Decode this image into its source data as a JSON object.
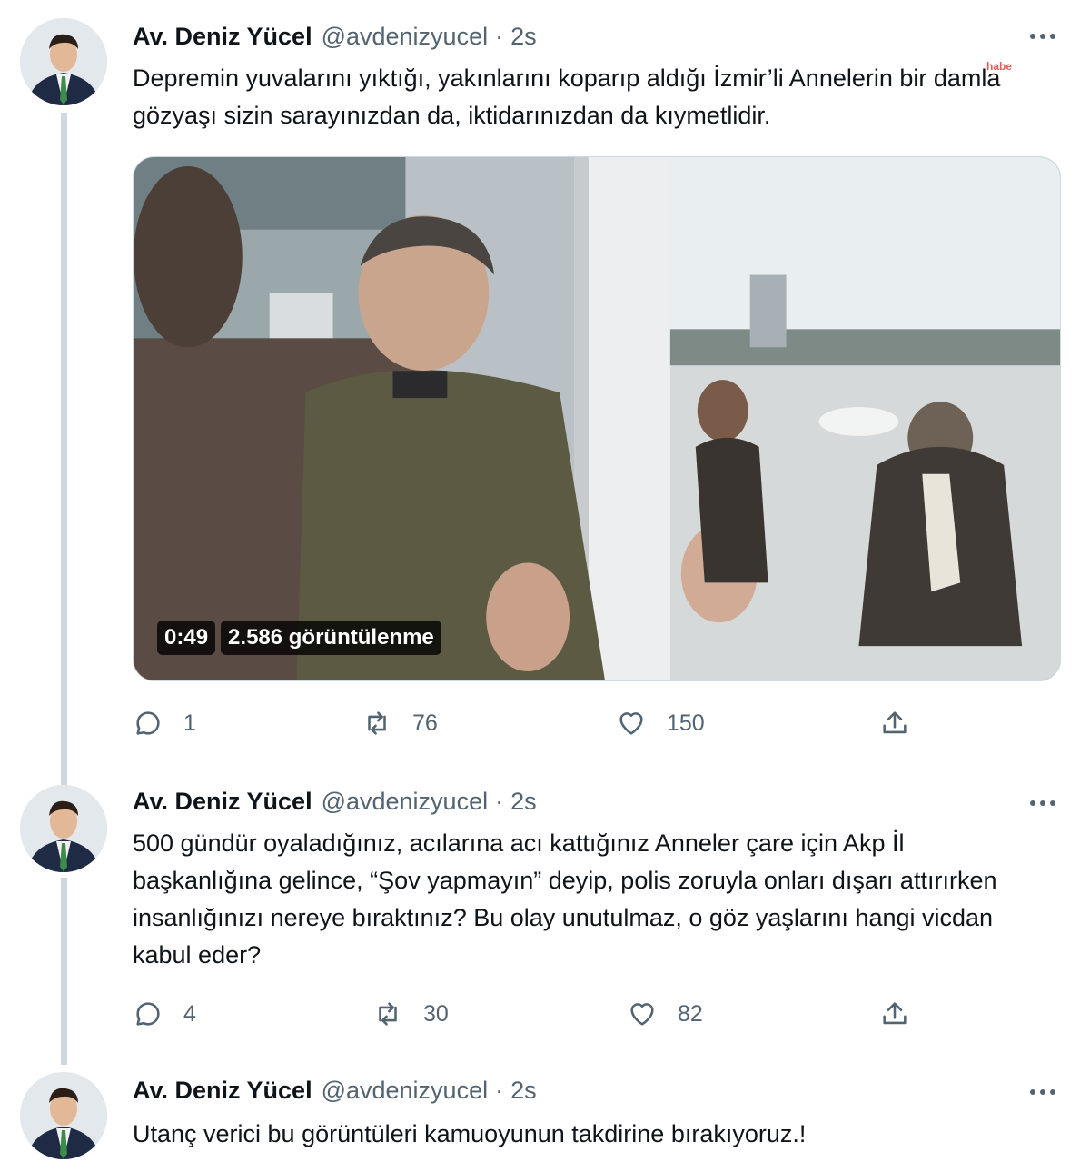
{
  "colors": {
    "text": "#0f1419",
    "secondary": "#536471",
    "thread_line": "#cfd9de"
  },
  "tweets": [
    {
      "author": "Av. Deniz Yücel",
      "handle": "@avdenizyucel",
      "separator": "·",
      "time": "2s",
      "text": "Depremin yuvalarını yıktığı, yakınlarını koparıp aldığı İzmir’li Annelerin bir damla gözyaşı sizin sarayınızdan da, iktidarınızdan da kıymetlidir.",
      "video": {
        "duration": "0:49",
        "views": "2.586 görüntülenme",
        "watermark": "habe"
      },
      "replies": "1",
      "retweets": "76",
      "likes": "150"
    },
    {
      "author": "Av. Deniz Yücel",
      "handle": "@avdenizyucel",
      "separator": "·",
      "time": "2s",
      "text": "500 gündür oyaladığınız, acılarına acı kattığınız Anneler çare için Akp İl başkanlığına gelince, “Şov yapmayın” deyip, polis zoruyla onları dışarı attırırken insanlığınızı nereye bıraktınız? Bu olay unutulmaz, o göz yaşlarını hangi vicdan kabul eder?",
      "replies": "4",
      "retweets": "30",
      "likes": "82"
    },
    {
      "author": "Av. Deniz Yücel",
      "handle": "@avdenizyucel",
      "separator": "·",
      "time": "2s",
      "text": "Utanç verici bu görüntüleri kamuoyunun takdirine bırakıyoruz.!"
    }
  ],
  "icons": {
    "more": "more-horizontal-icon",
    "reply": "reply-bubble-icon",
    "retweet": "retweet-arrows-icon",
    "like": "heart-outline-icon",
    "share": "share-upload-icon"
  }
}
